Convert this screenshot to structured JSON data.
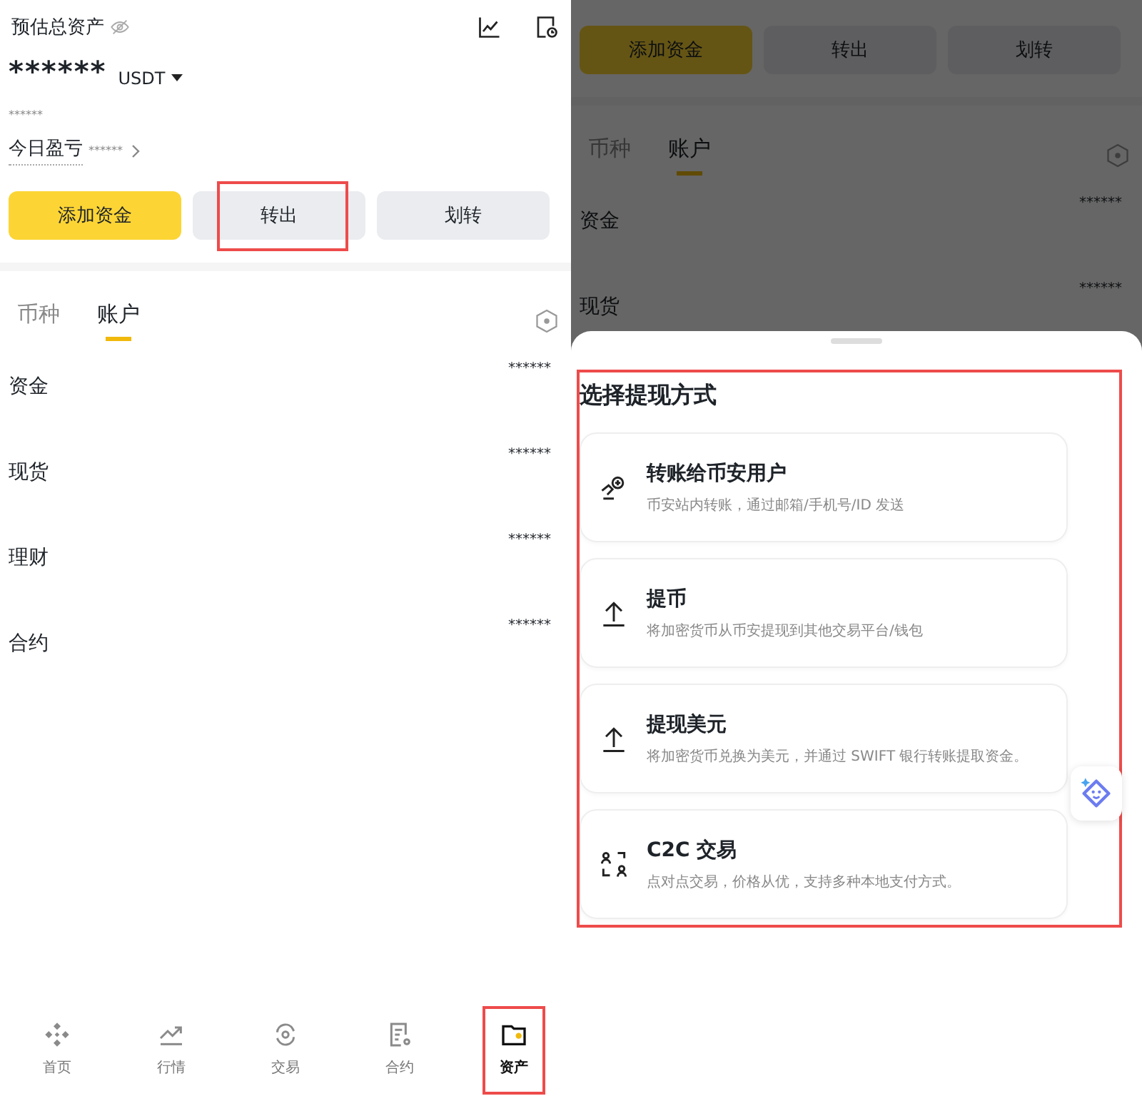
{
  "left": {
    "header": {
      "title": "预估总资产",
      "balance": "******",
      "currency": "USDT",
      "sub_balance": "******",
      "pnl_label": "今日盈亏",
      "pnl_value": "******"
    },
    "actions": [
      {
        "label": "添加资金",
        "kind": "primary",
        "highlighted": false
      },
      {
        "label": "转出",
        "kind": "secondary",
        "highlighted": true
      },
      {
        "label": "划转",
        "kind": "secondary",
        "highlighted": false
      }
    ],
    "tabs": [
      {
        "label": "币种",
        "selected": false
      },
      {
        "label": "账户",
        "selected": true
      }
    ],
    "accounts": [
      {
        "name": "资金",
        "value": "******"
      },
      {
        "name": "现货",
        "value": "******"
      },
      {
        "name": "理财",
        "value": "******"
      },
      {
        "name": "合约",
        "value": "******"
      }
    ],
    "nav": [
      {
        "label": "首页",
        "kind": "home",
        "selected": false,
        "highlighted": false
      },
      {
        "label": "行情",
        "kind": "markets",
        "selected": false,
        "highlighted": false
      },
      {
        "label": "交易",
        "kind": "trade",
        "selected": false,
        "highlighted": false
      },
      {
        "label": "合约",
        "kind": "futures",
        "selected": false,
        "highlighted": false
      },
      {
        "label": "资产",
        "kind": "assets",
        "selected": true,
        "highlighted": true
      }
    ]
  },
  "right": {
    "background": {
      "actions": [
        {
          "label": "添加资金",
          "kind": "primary"
        },
        {
          "label": "转出",
          "kind": "secondary"
        },
        {
          "label": "划转",
          "kind": "secondary"
        }
      ],
      "tabs": [
        {
          "label": "币种",
          "selected": false
        },
        {
          "label": "账户",
          "selected": true
        }
      ],
      "accounts": [
        {
          "name": "资金",
          "value": "******"
        },
        {
          "name": "现货",
          "value": "******"
        }
      ]
    },
    "sheet": {
      "title": "选择提现方式",
      "highlighted": true,
      "options": [
        {
          "kind": "hand",
          "title": "转账给币安用户",
          "description": "币安站内转账，通过邮箱/手机号/ID 发送"
        },
        {
          "kind": "upload",
          "title": "提币",
          "description": "将加密货币从币安提现到其他交易平台/钱包"
        },
        {
          "kind": "upload",
          "title": "提现美元",
          "description": "将加密货币兑换为美元，并通过 SWIFT 银行转账提取资金。"
        },
        {
          "kind": "people",
          "title": "C2C 交易",
          "description": "点对点交易，价格从优，支持多种本地支付方式。"
        }
      ]
    }
  }
}
